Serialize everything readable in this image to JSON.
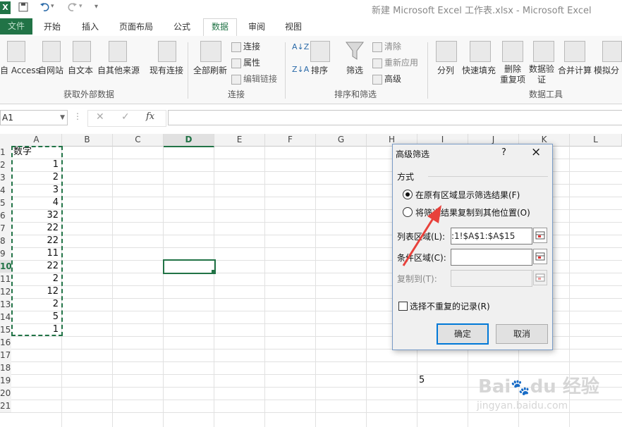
{
  "window": {
    "title": "新建 Microsoft Excel 工作表.xlsx - Microsoft Excel",
    "app_icon": "excel-icon",
    "qa_save": "save-icon",
    "qa_undo": "undo-icon",
    "qa_redo": "redo-icon"
  },
  "tabs": [
    {
      "label": "文件"
    },
    {
      "label": "开始"
    },
    {
      "label": "插入"
    },
    {
      "label": "页面布局"
    },
    {
      "label": "公式"
    },
    {
      "label": "数据"
    },
    {
      "label": "审阅"
    },
    {
      "label": "视图"
    }
  ],
  "ribbon": {
    "get_external": {
      "group": "获取外部数据",
      "access": "自 Access",
      "web": "自网站",
      "text": "自文本",
      "other": "自其他来源",
      "existing": "现有连接"
    },
    "connections": {
      "group": "连接",
      "refresh_all": "全部刷新",
      "connections": "连接",
      "properties": "属性",
      "edit_links": "编辑链接"
    },
    "sort_filter": {
      "group": "排序和筛选",
      "sort": "排序",
      "filter": "筛选",
      "clear": "清除",
      "reapply": "重新应用",
      "advanced": "高级"
    },
    "data_tools": {
      "group": "数据工具",
      "text_to_columns": "分列",
      "flash_fill": "快速填充",
      "remove_dup_1": "删除",
      "remove_dup_2": "重复项",
      "validation_1": "数据验",
      "validation_2": "证",
      "consolidate": "合并计算",
      "whatif": "模拟分"
    }
  },
  "formula_bar": {
    "name_box": "A1",
    "fx": "fx",
    "formula": ""
  },
  "grid": {
    "columns": [
      "A",
      "B",
      "C",
      "D",
      "E",
      "F",
      "G",
      "H",
      "I",
      "J",
      "K",
      "L"
    ],
    "rows": [
      "1",
      "2",
      "3",
      "4",
      "5",
      "6",
      "7",
      "8",
      "9",
      "10",
      "11",
      "12",
      "13",
      "14",
      "15",
      "16",
      "17",
      "18",
      "19",
      "20",
      "21"
    ],
    "a_header": "数字",
    "a_values": [
      "1",
      "2",
      "3",
      "4",
      "32",
      "22",
      "22",
      "11",
      "22",
      "2",
      "12",
      "2",
      "5",
      "1"
    ],
    "i19": "5"
  },
  "dialog": {
    "title": "高级筛选",
    "help": "?",
    "close": "×",
    "section": "方式",
    "option1": "在原有区域显示筛选结果(F)",
    "option2": "将筛选结果复制到其他位置(O)",
    "list_range_label": "列表区域(L):",
    "list_range_value": ":1!$A$1:$A$15",
    "criteria_label": "条件区域(C):",
    "criteria_value": "",
    "copy_to_label": "复制到(T):",
    "copy_to_value": "",
    "unique_label": "选择不重复的记录(R)",
    "ok": "确定",
    "cancel": "取消",
    "option1_selected": true
  },
  "accent": {
    "excel_green": "#217346",
    "arrow_red": "#e8413b"
  }
}
